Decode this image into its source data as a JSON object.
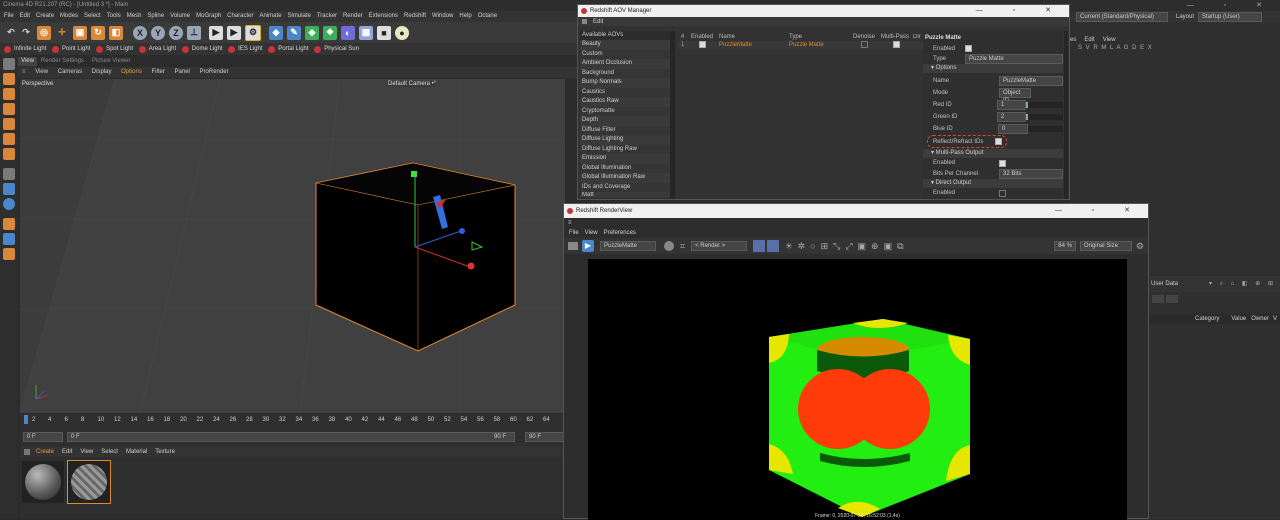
{
  "main": {
    "title": "Cinema 4D R21.207 (RC) - [Untitled 3 *] - Main",
    "menu": [
      "File",
      "Edit",
      "Create",
      "Modes",
      "Select",
      "Tools",
      "Mesh",
      "Spline",
      "Volume",
      "MoGraph",
      "Character",
      "Animate",
      "Simulate",
      "Tracker",
      "Render",
      "Extensions",
      "Redshift",
      "Window",
      "Help",
      "Octane"
    ],
    "lights": [
      "Infinite Light",
      "Point Light",
      "Spot Light",
      "Area Light",
      "Dome Light",
      "IES Light",
      "Portal Light",
      "Physical Sun"
    ],
    "viewport_tabs": [
      "View",
      "Render Settings",
      "Picture Viewer"
    ],
    "viewport_menu": [
      "View",
      "Cameras",
      "Display",
      "Options",
      "Filter",
      "Panel",
      "ProRender"
    ],
    "viewport_label": "Perspective",
    "camera_label": "Default Camera •°",
    "timeline_ticks": [
      "0",
      "2",
      "4",
      "6",
      "8",
      "10",
      "12",
      "14",
      "16",
      "18",
      "20",
      "22",
      "24",
      "26",
      "28",
      "30",
      "32",
      "34",
      "36",
      "38",
      "40",
      "42",
      "44",
      "46",
      "48",
      "50",
      "52",
      "54",
      "56",
      "58",
      "60",
      "62",
      "64"
    ],
    "frame_start": "0 F",
    "frame_current": "0 F",
    "frame_end": "90 F",
    "frame_end2": "90 F",
    "mat_menu": [
      "Create",
      "Edit",
      "View",
      "Select",
      "Material",
      "Texture"
    ],
    "right_top": {
      "render_setting": "Current (Standard/Physical)",
      "layout_label": "Layout",
      "layout_value": "Startup (User)",
      "menu": [
        "es",
        "Edit",
        "View"
      ],
      "letters": "S V R M L A G D E X"
    },
    "attributes": {
      "tab": "User Data",
      "columns": [
        "Category",
        "Value",
        "Owner",
        "V"
      ]
    }
  },
  "aov": {
    "title": "Redshift AOV Manager",
    "menu": "Edit",
    "list_header": "Available AOVs",
    "list": [
      "Beauty",
      "Custom",
      "Ambient Occlusion",
      "Background",
      "Bump Normals",
      "Caustics",
      "Caustics Raw",
      "Cryptomatte",
      "Depth",
      "Diffuse Filter",
      "Diffuse Lighting",
      "Diffuse Lighting Raw",
      "Emission",
      "Global Illumination",
      "Global Illumination Raw",
      "IDs and Coverage",
      "Matt"
    ],
    "table_headers": [
      "#",
      "Enabled",
      "Name",
      "Type",
      "Denoise",
      "Multi-Pass",
      "Dir"
    ],
    "row": {
      "num": "1",
      "name": "PuzzleMatte",
      "type": "Puzzle Matte"
    },
    "props": {
      "title": "Puzzle Matte",
      "enabled": "Enabled",
      "type_label": "Type",
      "type_value": "Puzzle Matte",
      "options_header": "▾ Options",
      "name_label": "Name",
      "name_value": "PuzzleMatte",
      "mode_label": "Mode",
      "mode_value": "Object ID",
      "red_label": "Red ID",
      "red_value": "1",
      "green_label": "Green ID",
      "green_value": "2",
      "blue_label": "Blue ID",
      "blue_value": "0",
      "reflect_label": "Reflect/Refract IDs",
      "multipass_header": "▾ Multi-Pass Output",
      "mp_enabled": "Enabled",
      "bits_label": "Bits Per Channel",
      "bits_value": "32 Bits",
      "direct_header": "▾ Direct Output",
      "do_enabled": "Enabled"
    }
  },
  "rv": {
    "title": "Redshift RenderView",
    "menu": [
      "File",
      "View",
      "Preferences"
    ],
    "aov_select": "PuzzleMatte",
    "render_select": "< Render >",
    "zoom": "84 %",
    "size_select": "Original Size",
    "status": "Frame: 0, 2020-07-20, 16:52:03 (1.4s)"
  },
  "colors": {
    "accent_orange": "#e08a2e",
    "cube_green": "#22ee11",
    "cube_yellow": "#e6e600",
    "cube_red": "#ff3b0a",
    "cube_orange": "#d68a00",
    "light_red": "#c8333a"
  }
}
